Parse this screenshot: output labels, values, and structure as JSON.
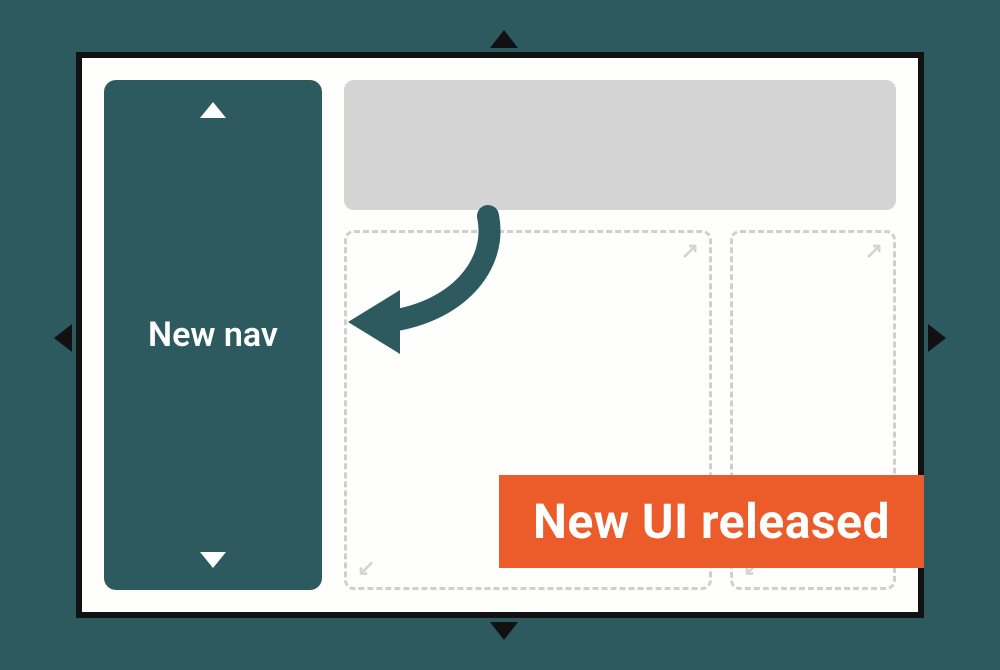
{
  "sidebar": {
    "label": "New nav"
  },
  "banner": {
    "text": "New UI released"
  },
  "icons": {
    "expand_ne": "↗",
    "expand_sw": "↙"
  },
  "colors": {
    "background": "#2C5A5E",
    "accent": "#EC5B2A",
    "frame": "#111111",
    "placeholder": "#D4D4D4"
  }
}
